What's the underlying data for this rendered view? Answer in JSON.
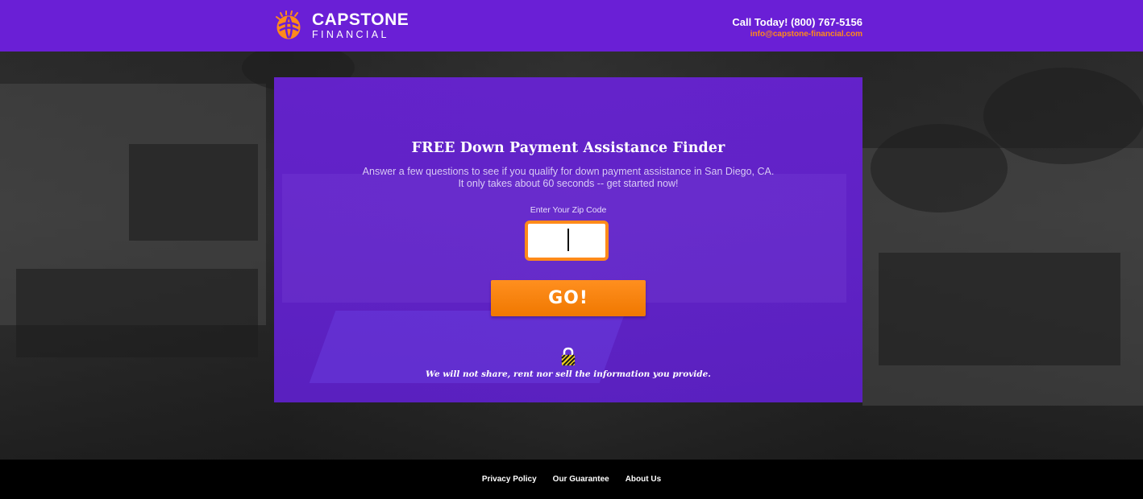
{
  "header": {
    "logo_name": "CAPSTONE",
    "logo_sub": "FINANCIAL",
    "phone": "Call Today! (800) 767-5156",
    "email": "info@capstone-financial.com"
  },
  "form": {
    "title": "FREE Down Payment Assistance Finder",
    "subtitle_line1": "Answer a few questions to see if you qualify for down payment assistance in San Diego, CA.",
    "subtitle_line2": "It only takes about 60 seconds -- get started now!",
    "zip_label": "Enter Your Zip Code",
    "zip_value": "",
    "go_label": "GO!",
    "privacy_note": "We will not share, rent nor sell the information you provide."
  },
  "footer": {
    "links": [
      "Privacy Policy",
      "Our Guarantee",
      "About Us"
    ]
  },
  "colors": {
    "brand_purple": "#6a1fd6",
    "accent_orange": "#ff8a1a",
    "footer_black": "#000000"
  },
  "icons": {
    "logo": "globe-icon",
    "lock": "lock-icon"
  }
}
